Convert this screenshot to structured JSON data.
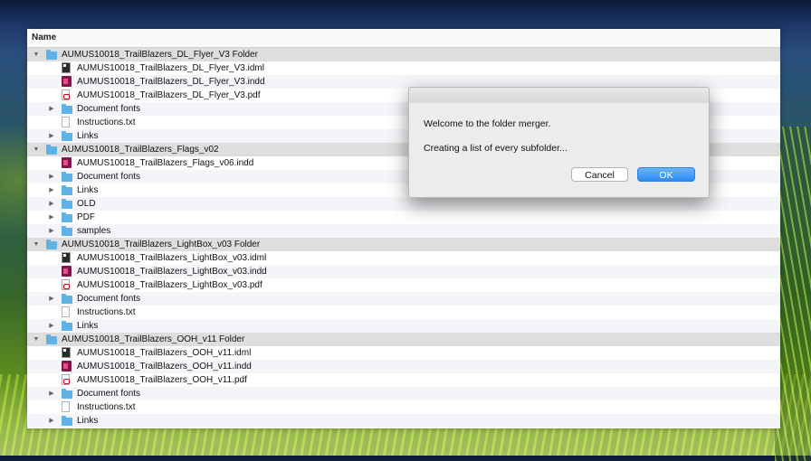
{
  "column_header": "Name",
  "rows": [
    {
      "level": 0,
      "expand": "open",
      "type": "folder",
      "label": "AUMUS10018_TrailBlazers_DL_Flyer_V3 Folder"
    },
    {
      "level": 1,
      "expand": "none",
      "type": "idml",
      "label": "AUMUS10018_TrailBlazers_DL_Flyer_V3.idml"
    },
    {
      "level": 1,
      "expand": "none",
      "type": "indd",
      "label": "AUMUS10018_TrailBlazers_DL_Flyer_V3.indd"
    },
    {
      "level": 1,
      "expand": "none",
      "type": "pdf",
      "label": "AUMUS10018_TrailBlazers_DL_Flyer_V3.pdf"
    },
    {
      "level": 1,
      "expand": "closed",
      "type": "folder",
      "label": "Document fonts"
    },
    {
      "level": 1,
      "expand": "none",
      "type": "txt",
      "label": "Instructions.txt"
    },
    {
      "level": 1,
      "expand": "closed",
      "type": "folder",
      "label": "Links"
    },
    {
      "level": 0,
      "expand": "open",
      "type": "folder",
      "label": "AUMUS10018_TrailBlazers_Flags_v02"
    },
    {
      "level": 1,
      "expand": "none",
      "type": "indd",
      "label": "AUMUS10018_TrailBlazers_Flags_v06.indd"
    },
    {
      "level": 1,
      "expand": "closed",
      "type": "folder",
      "label": "Document fonts"
    },
    {
      "level": 1,
      "expand": "closed",
      "type": "folder",
      "label": "Links"
    },
    {
      "level": 1,
      "expand": "closed",
      "type": "folder",
      "label": "OLD"
    },
    {
      "level": 1,
      "expand": "closed",
      "type": "folder",
      "label": "PDF"
    },
    {
      "level": 1,
      "expand": "closed",
      "type": "folder",
      "label": "samples"
    },
    {
      "level": 0,
      "expand": "open",
      "type": "folder",
      "label": "AUMUS10018_TrailBlazers_LightBox_v03 Folder"
    },
    {
      "level": 1,
      "expand": "none",
      "type": "idml",
      "label": "AUMUS10018_TrailBlazers_LightBox_v03.idml"
    },
    {
      "level": 1,
      "expand": "none",
      "type": "indd",
      "label": "AUMUS10018_TrailBlazers_LightBox_v03.indd"
    },
    {
      "level": 1,
      "expand": "none",
      "type": "pdf",
      "label": "AUMUS10018_TrailBlazers_LightBox_v03.pdf"
    },
    {
      "level": 1,
      "expand": "closed",
      "type": "folder",
      "label": "Document fonts"
    },
    {
      "level": 1,
      "expand": "none",
      "type": "txt",
      "label": "Instructions.txt"
    },
    {
      "level": 1,
      "expand": "closed",
      "type": "folder",
      "label": "Links"
    },
    {
      "level": 0,
      "expand": "open",
      "type": "folder",
      "label": "AUMUS10018_TrailBlazers_OOH_v11 Folder"
    },
    {
      "level": 1,
      "expand": "none",
      "type": "idml",
      "label": "AUMUS10018_TrailBlazers_OOH_v11.idml"
    },
    {
      "level": 1,
      "expand": "none",
      "type": "indd",
      "label": "AUMUS10018_TrailBlazers_OOH_v11.indd"
    },
    {
      "level": 1,
      "expand": "none",
      "type": "pdf",
      "label": "AUMUS10018_TrailBlazers_OOH_v11.pdf"
    },
    {
      "level": 1,
      "expand": "closed",
      "type": "folder",
      "label": "Document fonts"
    },
    {
      "level": 1,
      "expand": "none",
      "type": "txt",
      "label": "Instructions.txt"
    },
    {
      "level": 1,
      "expand": "closed",
      "type": "folder",
      "label": "Links"
    }
  ],
  "dialog": {
    "message": "Welcome to the folder merger.",
    "status": "Creating a list of every subfolder...",
    "cancel_label": "Cancel",
    "ok_label": "OK"
  },
  "colors": {
    "folder": "#5eb2e6",
    "ok_button": "#2f8cf5",
    "group_row": "#dedede"
  }
}
